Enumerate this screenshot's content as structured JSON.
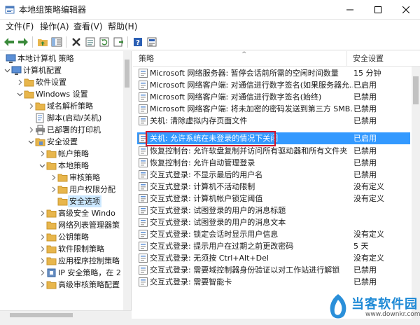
{
  "window": {
    "title": "本地组策略编辑器"
  },
  "menu": [
    "文件(F)",
    "操作(A)",
    "查看(V)",
    "帮助(H)"
  ],
  "toolbar": [
    "back-icon",
    "forward-icon",
    "up-folder-icon",
    "show-hide-tree-icon",
    "delete-icon",
    "properties-icon",
    "refresh-icon",
    "export-list-icon",
    "help-icon",
    "view-icon"
  ],
  "tree": [
    {
      "label": "本地计算机 策略",
      "icon": "computer-icon"
    },
    {
      "label": "计算机配置",
      "icon": "computer-icon"
    },
    {
      "label": "软件设置",
      "icon": "folder-icon"
    },
    {
      "label": "Windows 设置",
      "icon": "folder-icon"
    },
    {
      "label": "域名解析策略",
      "icon": "folder-icon"
    },
    {
      "label": "脚本(启动/关机)",
      "icon": "script-icon"
    },
    {
      "label": "已部署的打印机",
      "icon": "printer-icon"
    },
    {
      "label": "安全设置",
      "icon": "security-icon"
    },
    {
      "label": "帐户策略",
      "icon": "folder-icon"
    },
    {
      "label": "本地策略",
      "icon": "folder-icon"
    },
    {
      "label": "审核策略",
      "icon": "folder-icon"
    },
    {
      "label": "用户权限分配",
      "icon": "folder-icon"
    },
    {
      "label": "安全选项",
      "icon": "folder-icon"
    },
    {
      "label": "高级安全 Windo",
      "icon": "folder-icon"
    },
    {
      "label": "网络列表管理器策",
      "icon": "folder-icon"
    },
    {
      "label": "公钥策略",
      "icon": "folder-icon"
    },
    {
      "label": "软件限制策略",
      "icon": "folder-icon"
    },
    {
      "label": "应用程序控制策略",
      "icon": "folder-icon"
    },
    {
      "label": "IP 安全策略，在 2",
      "icon": "ip-security-icon"
    },
    {
      "label": "高级审核策略配置",
      "icon": "folder-icon"
    }
  ],
  "columns": {
    "policy": "策略",
    "setting": "安全设置"
  },
  "rows": [
    {
      "name": "Microsoft 网络服务器: 暂停会话前所需的空闲时间数量",
      "value": "15 分钟"
    },
    {
      "name": "Microsoft 网络客户端: 对通信进行数字签名(如果服务器允...",
      "value": "已启用"
    },
    {
      "name": "Microsoft 网络客户端: 对通信进行数字签名(始终)",
      "value": "已禁用"
    },
    {
      "name": "Microsoft 网络客户端: 将未加密的密码发送到第三方 SMB...",
      "value": "已禁用"
    },
    {
      "name": "关机: 清除虚拟内存页面文件",
      "value": "已禁用"
    },
    {
      "name": "关机: 允许系统在未登录的情况下关闭",
      "value": "已启用"
    },
    {
      "name": "恢复控制台: 允许软盘复制并访问所有驱动器和所有文件夹",
      "value": "已禁用"
    },
    {
      "name": "恢复控制台: 允许自动管理登录",
      "value": "已禁用"
    },
    {
      "name": "交互式登录: 不显示最后的用户名",
      "value": "已禁用"
    },
    {
      "name": "交互式登录: 计算机不活动限制",
      "value": "没有定义"
    },
    {
      "name": "交互式登录: 计算机帐户锁定阈值",
      "value": "没有定义"
    },
    {
      "name": "交互式登录: 试图登录的用户的消息标题",
      "value": ""
    },
    {
      "name": "交互式登录: 试图登录的用户的消息文本",
      "value": ""
    },
    {
      "name": "交互式登录: 锁定会话时显示用户信息",
      "value": "没有定义"
    },
    {
      "name": "交互式登录: 提示用户在过期之前更改密码",
      "value": "5 天"
    },
    {
      "name": "交互式登录: 无须按 Ctrl+Alt+Del",
      "value": "没有定义"
    },
    {
      "name": "交互式登录: 需要域控制器身份验证以对工作站进行解锁",
      "value": "已禁用"
    },
    {
      "name": "交互式登录: 需要智能卡",
      "value": "已禁用"
    }
  ],
  "watermark": {
    "text": "当客软件园",
    "url": "www.downkr.com"
  },
  "colors": {
    "selection": "#3399ff",
    "highlight_border": "#d3142b",
    "folder": "#e8b64c"
  }
}
